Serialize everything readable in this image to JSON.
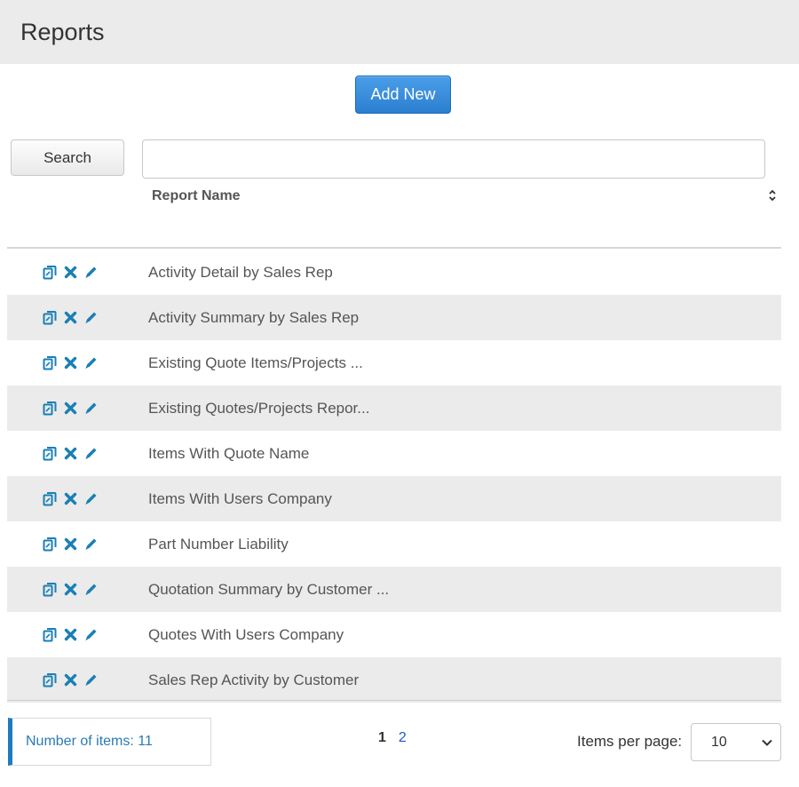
{
  "header": {
    "title": "Reports"
  },
  "toolbar": {
    "add_new_label": "Add New",
    "search_label": "Search",
    "search_value": "",
    "search_placeholder": ""
  },
  "table": {
    "column_header": "Report Name",
    "rows": [
      "Activity Detail by Sales Rep",
      "Activity Summary by Sales Rep",
      "Existing Quote Items/Projects ...",
      "Existing Quotes/Projects Repor...",
      "Items With Quote Name",
      "Items With Users Company",
      "Part Number Liability",
      "Quotation Summary by Customer ...",
      "Quotes With Users Company",
      "Sales Rep Activity by Customer"
    ]
  },
  "footer": {
    "count_label": "Number of items: 11",
    "pages": [
      "1",
      "2"
    ],
    "items_per_page_label": "Items per page:",
    "items_per_page_value": "10"
  },
  "colors": {
    "icon": "#1a7fb5",
    "accent": "#2b7fd0",
    "row_alt": "#ebebeb"
  },
  "icons": {
    "copy": "copy-icon",
    "delete": "delete-icon",
    "edit": "pencil-icon",
    "sort": "sort-icon",
    "chevron": "chevron-down-icon"
  }
}
